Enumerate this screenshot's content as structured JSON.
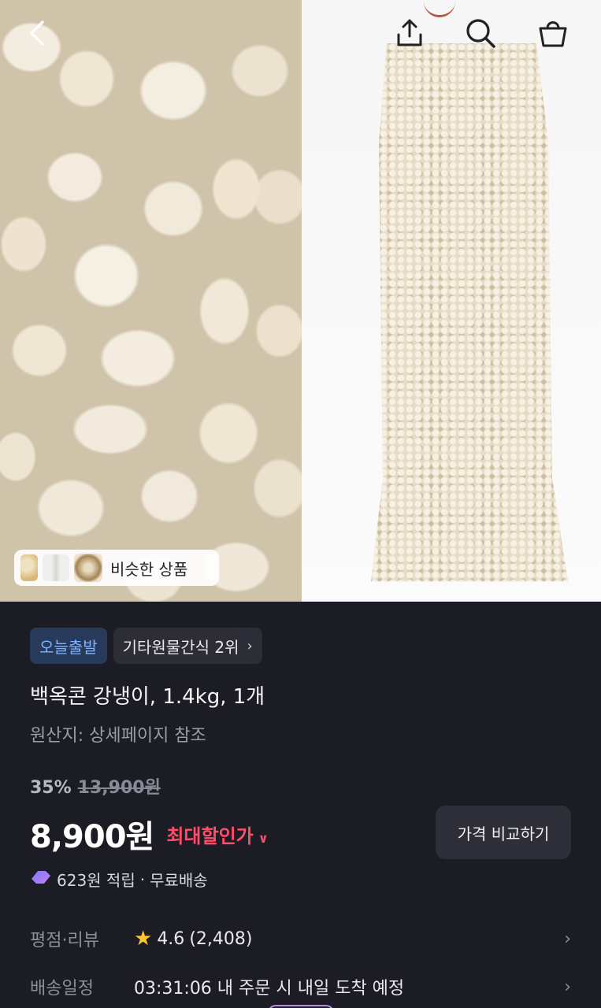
{
  "similar_products_label": "비슷한 상품",
  "badges": {
    "today_departure": "오늘출발",
    "category_rank": "기타원물간식 2위"
  },
  "product": {
    "title": "백옥콘 강냉이, 1.4kg, 1개",
    "origin": "원산지: 상세페이지 참조"
  },
  "pricing": {
    "discount_rate": "35%",
    "original_price": "13,900원",
    "sale_price": "8,900원",
    "max_discount_label": "최대할인가",
    "compare_button": "가격 비교하기",
    "points": "623원 적립",
    "separator": "·",
    "shipping_fee": "무료배송"
  },
  "rating": {
    "label": "평점·리뷰",
    "score": "4.6",
    "count": "(2,408)"
  },
  "delivery": {
    "label": "배송일정",
    "text": "03:31:06 내 주문 시 내일 도착 예정"
  },
  "colors": {
    "background": "#1c1c24",
    "accent_red": "#ff4d6a",
    "badge_blue": "#7fb2ff",
    "star": "#ffc629"
  },
  "icons": [
    "back-icon",
    "share-icon",
    "search-icon",
    "cart-icon",
    "chevron-right-icon",
    "chevron-down-icon",
    "star-icon",
    "points-icon"
  ]
}
